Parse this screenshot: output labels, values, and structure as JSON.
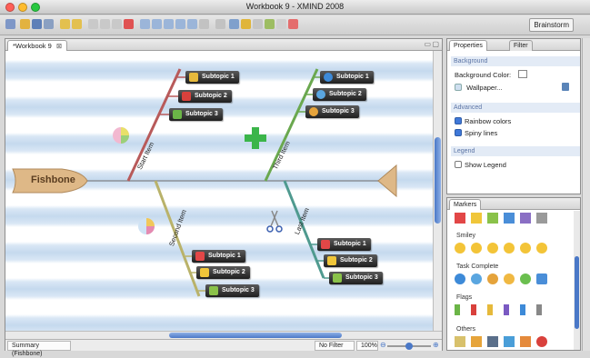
{
  "window": {
    "title": "Workbook 9 - XMIND 2008"
  },
  "toolbar": {
    "brainstorm_label": "Brainstorm"
  },
  "editor": {
    "tab_label": "*Workbook 9",
    "status": {
      "summary": "Summary (Fishbone)",
      "filter": "No Filter",
      "zoom": "100%"
    }
  },
  "map": {
    "head": "Fishbone",
    "branches": {
      "start": {
        "label": "Start Item",
        "subtopics": [
          "Subtopic 1",
          "Subtopic 2",
          "Subtopic 3"
        ]
      },
      "third": {
        "label": "Third Item",
        "subtopics": [
          "Subtopic 1",
          "Subtopic 2",
          "Subtopic 3"
        ]
      },
      "second": {
        "label": "Second Item",
        "subtopics": [
          "Subtopic 1",
          "Subtopic 2",
          "Subtopic 3"
        ]
      },
      "last": {
        "label": "Last Item",
        "subtopics": [
          "Subtopic 1",
          "Subtopic 2",
          "Subtopic 3"
        ]
      }
    }
  },
  "properties": {
    "tab_label": "Properties",
    "filter_tab_label": "Filter",
    "background_section": "Background",
    "background_color_label": "Background Color:",
    "wallpaper_label": "Wallpaper...",
    "advanced_section": "Advanced",
    "rainbow_colors": {
      "label": "Rainbow colors",
      "checked": true
    },
    "spiny_lines": {
      "label": "Spiny lines",
      "checked": true
    },
    "legend_section": "Legend",
    "show_legend": {
      "label": "Show Legend",
      "checked": false
    }
  },
  "markers": {
    "tab_label": "Markers",
    "groups": [
      "Smiley",
      "Task Complete",
      "Flags",
      "Others"
    ]
  }
}
